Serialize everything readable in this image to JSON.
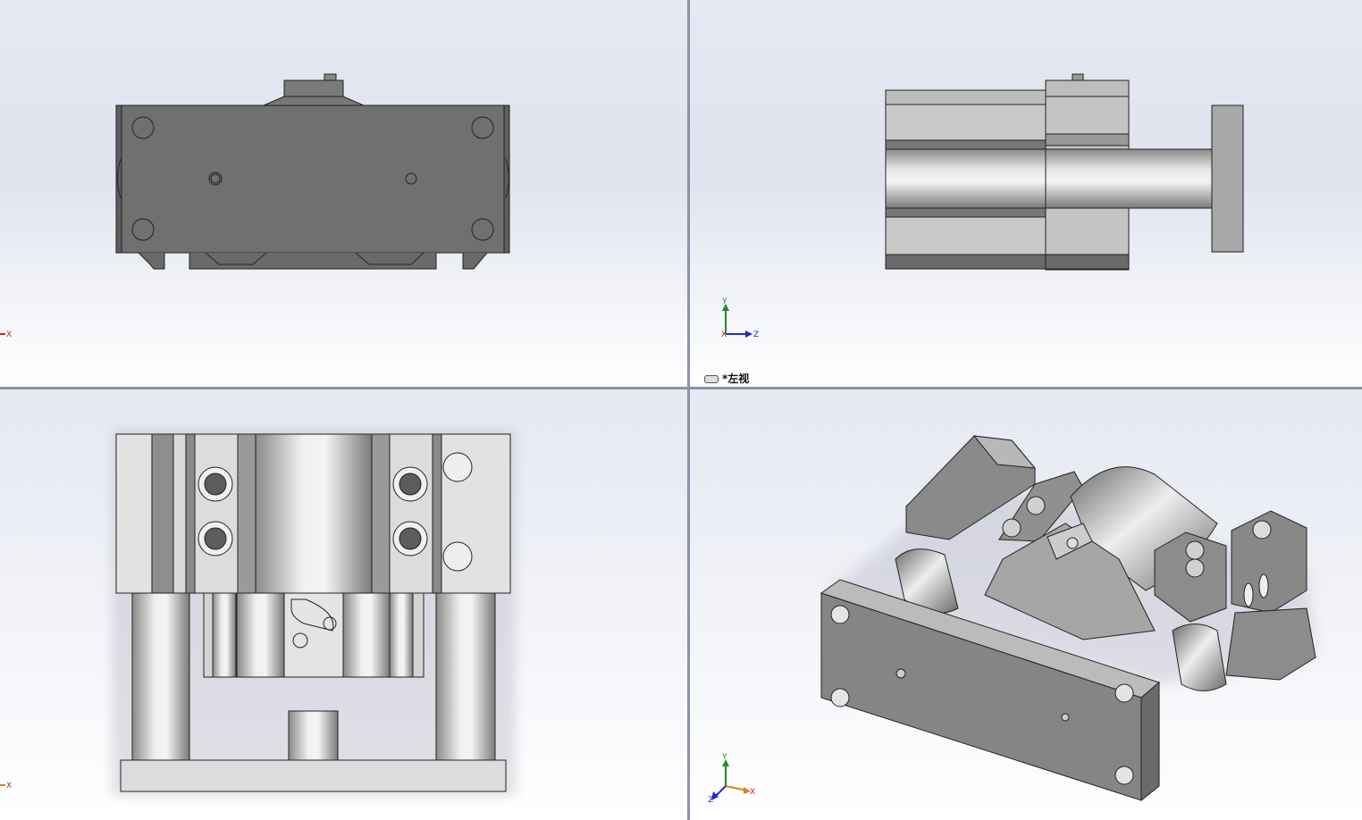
{
  "viewports": {
    "top_left": {
      "label": "",
      "triad_labels": {
        "x": "X"
      }
    },
    "top_right": {
      "label": "*左视",
      "triad_labels": {
        "x": "X",
        "y": "Y",
        "z": "Z"
      }
    },
    "bottom_left": {
      "label": "",
      "triad_labels": {
        "x": "X"
      }
    },
    "bottom_right": {
      "label": "",
      "triad_labels": {
        "x": "X",
        "y": "Y",
        "z": "Z"
      }
    }
  },
  "colors": {
    "background_top": "#eef0f6",
    "background_bottom": "#ffffff",
    "divider": "#8a93aa",
    "part_dark": "#6f6f6f",
    "part_mid": "#9a9a9a",
    "part_light": "#d8d8d8",
    "axis_x": "#c8281e",
    "axis_y": "#1e8c28",
    "axis_z": "#1e2cc8"
  }
}
